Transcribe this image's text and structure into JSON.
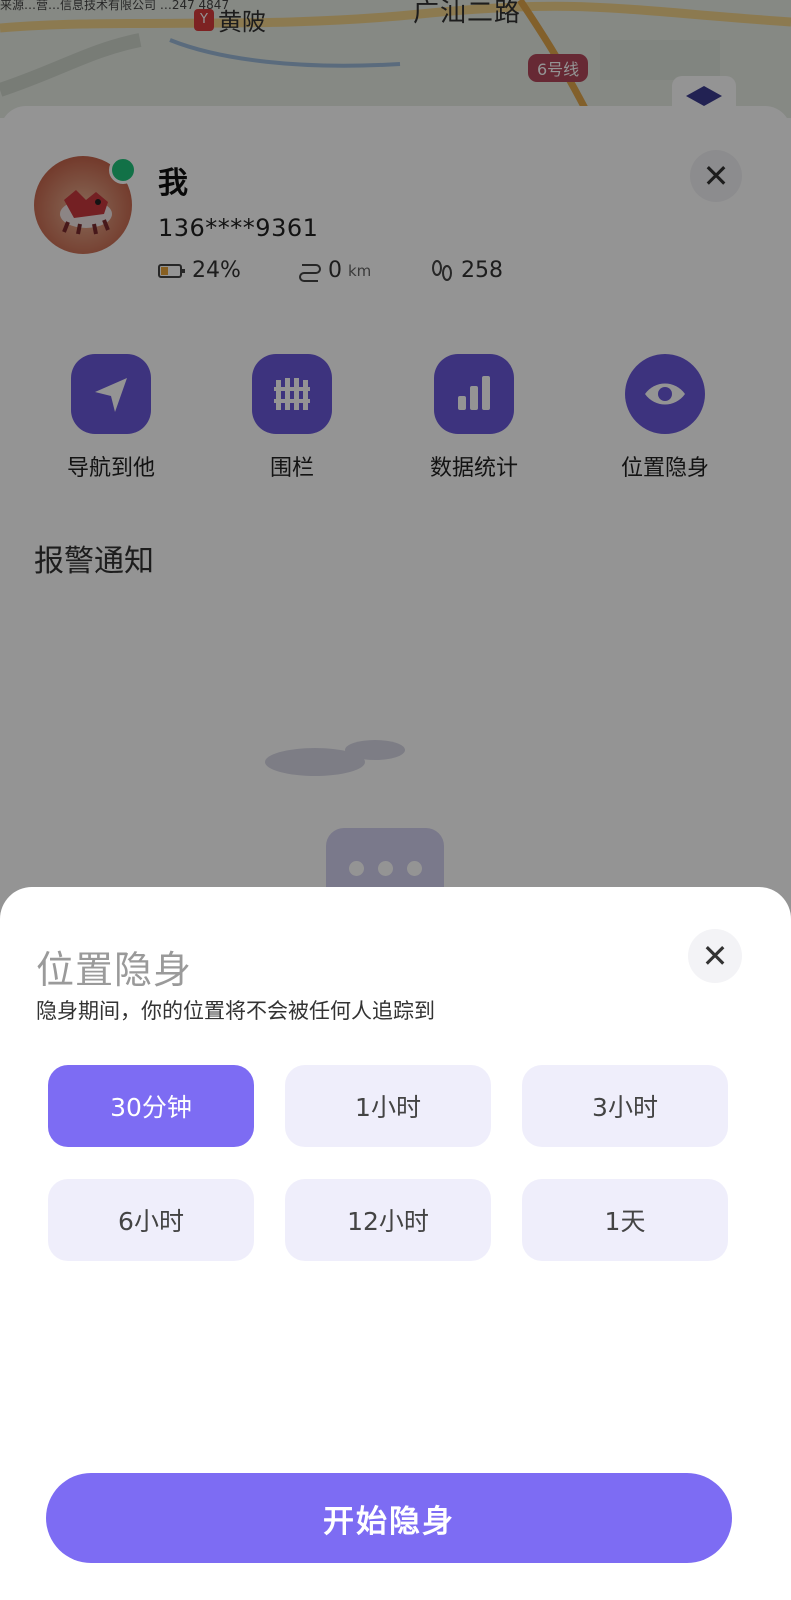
{
  "map": {
    "top_line_text": "来源…营…信息技术有限公司 …247 4847",
    "metro_station": "黄陂",
    "metro_mark": "Y",
    "road_name": "广汕二路",
    "line_badge": "6号线"
  },
  "profile": {
    "name": "我",
    "phone": "136****9361",
    "battery": "24%",
    "distance_value": "0",
    "distance_unit": "km",
    "steps": "258",
    "close_glyph": "✕"
  },
  "actions": [
    {
      "label": "导航到他",
      "icon": "navigation-arrow-icon"
    },
    {
      "label": "围栏",
      "icon": "fence-icon"
    },
    {
      "label": "数据统计",
      "icon": "bar-chart-icon"
    },
    {
      "label": "位置隐身",
      "icon": "eye-icon"
    }
  ],
  "alarm": {
    "title": "报警通知"
  },
  "sheet": {
    "title": "位置隐身",
    "description": "隐身期间，你的位置将不会被任何人追踪到",
    "close_glyph": "✕",
    "options": [
      "30分钟",
      "1小时",
      "3小时",
      "6小时",
      "12小时",
      "1天"
    ],
    "selected_option": "30分钟",
    "start_label": "开始隐身"
  },
  "colors": {
    "accent": "#7d6cf3",
    "icon_bg": "#6a58d9",
    "option_bg": "#efeefb",
    "online": "#1fc37b"
  }
}
